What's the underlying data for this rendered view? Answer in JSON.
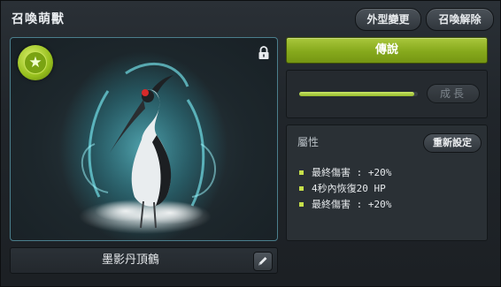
{
  "window": {
    "title": "召喚萌獸"
  },
  "header": {
    "appearance_label": "外型變更",
    "release_label": "召喚解除"
  },
  "pet": {
    "name": "墨影丹頂鶴",
    "icons": {
      "badge": "star-icon",
      "lock": "lock-icon",
      "edit": "pencil-icon"
    }
  },
  "grade": {
    "label": "傳說",
    "color": "#86a91c"
  },
  "growth": {
    "button_label": "成長",
    "progress": 0.97
  },
  "attributes": {
    "title": "屬性",
    "reset_label": "重新設定",
    "stats": [
      "最終傷害 : +20%",
      "4秒內恢復20 HP",
      "最終傷害 : +20%"
    ]
  }
}
